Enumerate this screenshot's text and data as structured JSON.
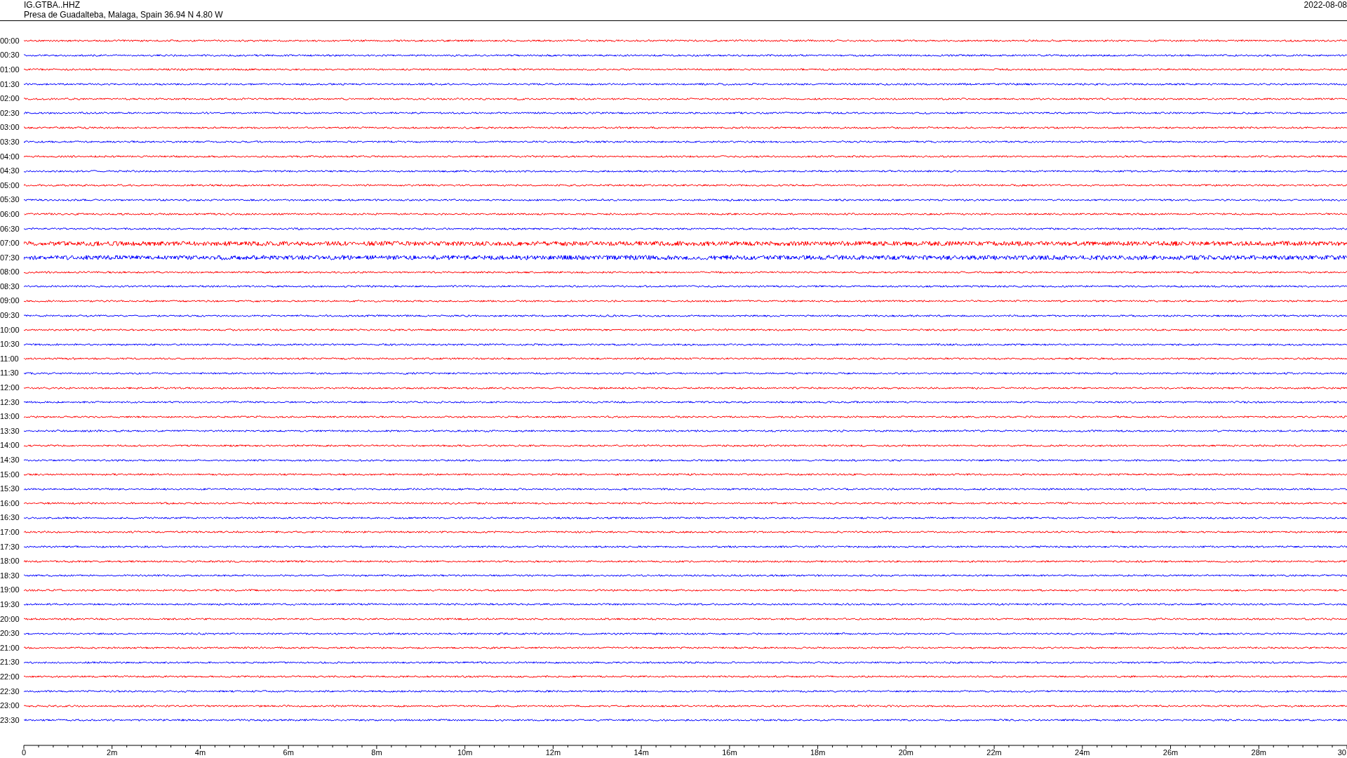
{
  "header": {
    "station": "IG.GTBA..HHZ",
    "location": "Presa de Guadalteba, Malaga, Spain  36.94 N 4.80 W",
    "date": "2022-08-08"
  },
  "rows": [
    {
      "time": "00:00",
      "color": "#ff0000",
      "kind": "quiet"
    },
    {
      "time": "00:30",
      "color": "#0000ff",
      "kind": "quiet"
    },
    {
      "time": "01:00",
      "color": "#ff0000",
      "kind": "quiet"
    },
    {
      "time": "01:30",
      "color": "#0000ff",
      "kind": "quiet"
    },
    {
      "time": "02:00",
      "color": "#ff0000",
      "kind": "quiet"
    },
    {
      "time": "02:30",
      "color": "#0000ff",
      "kind": "quiet"
    },
    {
      "time": "03:00",
      "color": "#ff0000",
      "kind": "quiet"
    },
    {
      "time": "03:30",
      "color": "#0000ff",
      "kind": "quiet"
    },
    {
      "time": "04:00",
      "color": "#ff0000",
      "kind": "quiet"
    },
    {
      "time": "04:30",
      "color": "#0000ff",
      "kind": "quiet"
    },
    {
      "time": "05:00",
      "color": "#ff0000",
      "kind": "quiet"
    },
    {
      "time": "05:30",
      "color": "#0000ff",
      "kind": "quiet"
    },
    {
      "time": "06:00",
      "color": "#ff0000",
      "kind": "quiet"
    },
    {
      "time": "06:30",
      "color": "#0000ff",
      "kind": "quiet"
    },
    {
      "time": "07:00",
      "color": "#ff0000",
      "kind": "noisy"
    },
    {
      "time": "07:30",
      "color": "#0000ff",
      "kind": "noisy"
    },
    {
      "time": "08:00",
      "color": "#ff0000",
      "kind": "quiet"
    },
    {
      "time": "08:30",
      "color": "#0000ff",
      "kind": "quiet"
    },
    {
      "time": "09:00",
      "color": "#ff0000",
      "kind": "quiet"
    },
    {
      "time": "09:30",
      "color": "#0000ff",
      "kind": "quiet"
    },
    {
      "time": "10:00",
      "color": "#ff0000",
      "kind": "quiet"
    },
    {
      "time": "10:30",
      "color": "#0000ff",
      "kind": "quiet"
    },
    {
      "time": "11:00",
      "color": "#ff0000",
      "kind": "quiet"
    },
    {
      "time": "11:30",
      "color": "#0000ff",
      "kind": "quiet"
    },
    {
      "time": "12:00",
      "color": "#ff0000",
      "kind": "quiet"
    },
    {
      "time": "12:30",
      "color": "#0000ff",
      "kind": "quiet"
    },
    {
      "time": "13:00",
      "color": "#ff0000",
      "kind": "quiet"
    },
    {
      "time": "13:30",
      "color": "#0000ff",
      "kind": "quiet"
    },
    {
      "time": "14:00",
      "color": "#ff0000",
      "kind": "quiet"
    },
    {
      "time": "14:30",
      "color": "#0000ff",
      "kind": "quiet"
    },
    {
      "time": "15:00",
      "color": "#ff0000",
      "kind": "quiet"
    },
    {
      "time": "15:30",
      "color": "#0000ff",
      "kind": "quiet"
    },
    {
      "time": "16:00",
      "color": "#ff0000",
      "kind": "quiet"
    },
    {
      "time": "16:30",
      "color": "#0000ff",
      "kind": "quiet"
    },
    {
      "time": "17:00",
      "color": "#ff0000",
      "kind": "quiet"
    },
    {
      "time": "17:30",
      "color": "#0000ff",
      "kind": "quiet"
    },
    {
      "time": "18:00",
      "color": "#ff0000",
      "kind": "quiet"
    },
    {
      "time": "18:30",
      "color": "#0000ff",
      "kind": "quiet"
    },
    {
      "time": "19:00",
      "color": "#ff0000",
      "kind": "quiet"
    },
    {
      "time": "19:30",
      "color": "#0000ff",
      "kind": "quiet"
    },
    {
      "time": "20:00",
      "color": "#ff0000",
      "kind": "quiet"
    },
    {
      "time": "20:30",
      "color": "#0000ff",
      "kind": "quiet"
    },
    {
      "time": "21:00",
      "color": "#ff0000",
      "kind": "quiet"
    },
    {
      "time": "21:30",
      "color": "#0000ff",
      "kind": "quiet"
    },
    {
      "time": "22:00",
      "color": "#ff0000",
      "kind": "quiet"
    },
    {
      "time": "22:30",
      "color": "#0000ff",
      "kind": "quiet"
    },
    {
      "time": "23:00",
      "color": "#ff0000",
      "kind": "quiet"
    },
    {
      "time": "23:30",
      "color": "#0000ff",
      "kind": "quiet"
    }
  ],
  "x_axis": {
    "ticks": [
      "0",
      "2m",
      "4m",
      "6m",
      "8m",
      "10m",
      "12m",
      "14m",
      "16m",
      "18m",
      "20m",
      "22m",
      "24m",
      "26m",
      "28m",
      "30"
    ]
  }
}
